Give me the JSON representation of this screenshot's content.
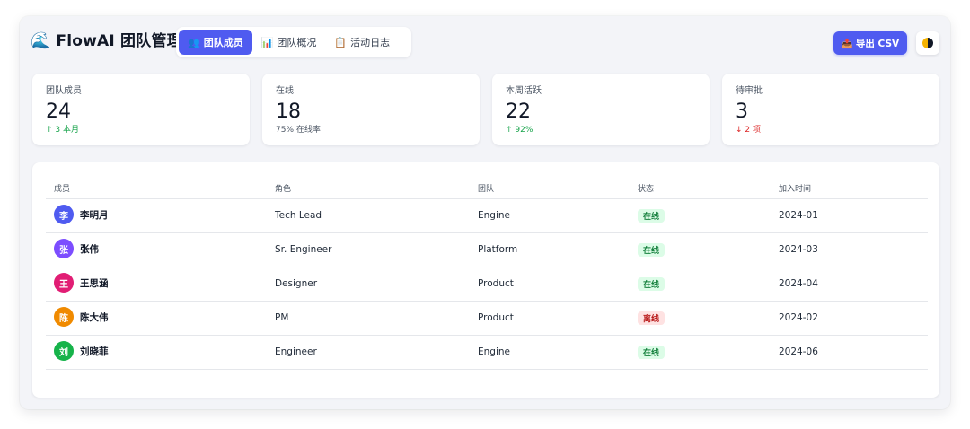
{
  "header": {
    "brand_icon": "🌊",
    "title": "FlowAI 团队管理",
    "tabs": [
      {
        "icon": "👥",
        "label": "团队成员",
        "active": true
      },
      {
        "icon": "📊",
        "label": "团队概况",
        "active": false
      },
      {
        "icon": "📋",
        "label": "活动日志",
        "active": false
      }
    ],
    "export": {
      "icon": "📤",
      "label": "导出 CSV"
    },
    "theme_icon": "half-moon-icon",
    "accent": "#4f5bf0"
  },
  "stats": [
    {
      "label": "团队成员",
      "value": "24",
      "sub": "↑ 3 本月",
      "trend": "up"
    },
    {
      "label": "在线",
      "value": "18",
      "sub": "75% 在线率",
      "trend": "neutral"
    },
    {
      "label": "本周活跃",
      "value": "22",
      "sub": "↑ 92%",
      "trend": "up"
    },
    {
      "label": "待审批",
      "value": "3",
      "sub": "↓ 2 项",
      "trend": "down"
    }
  ],
  "table": {
    "columns": [
      "成员",
      "角色",
      "团队",
      "状态",
      "加入时间"
    ],
    "rows": [
      {
        "initial": "李",
        "name": "李明月",
        "role": "Tech Lead",
        "team": "Engine",
        "status": "在线",
        "status_type": "online",
        "joined": "2024-01",
        "color": "#4f5bf0"
      },
      {
        "initial": "张",
        "name": "张伟",
        "role": "Sr. Engineer",
        "team": "Platform",
        "status": "在线",
        "status_type": "online",
        "joined": "2024-03",
        "color": "#7c4dff"
      },
      {
        "initial": "王",
        "name": "王思涵",
        "role": "Designer",
        "team": "Product",
        "status": "在线",
        "status_type": "online",
        "joined": "2024-04",
        "color": "#e11d74"
      },
      {
        "initial": "陈",
        "name": "陈大伟",
        "role": "PM",
        "team": "Product",
        "status": "离线",
        "status_type": "offline",
        "joined": "2024-02",
        "color": "#f08a00"
      },
      {
        "initial": "刘",
        "name": "刘晓菲",
        "role": "Engineer",
        "team": "Engine",
        "status": "在线",
        "status_type": "online",
        "joined": "2024-06",
        "color": "#16b34a"
      }
    ]
  }
}
